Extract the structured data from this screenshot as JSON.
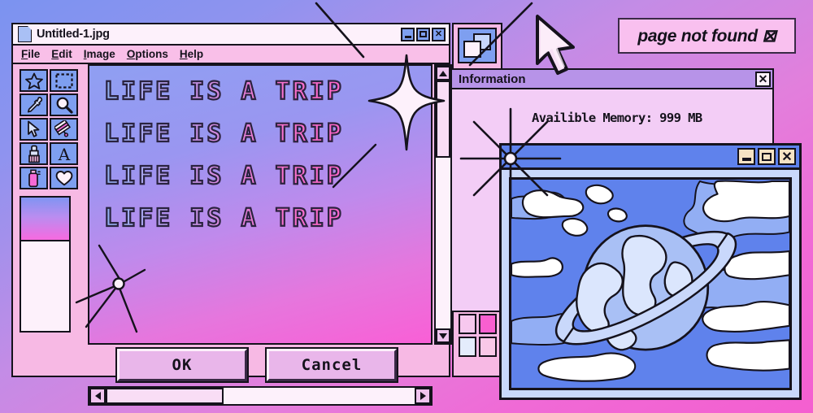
{
  "background": {
    "gradient_from": "#7b93f0",
    "gradient_to": "#f45fd0"
  },
  "paint_window": {
    "title": "Untitled-1.jpg",
    "doc_icon": "document-icon",
    "menu": [
      {
        "label": "File",
        "accel": "F"
      },
      {
        "label": "Edit",
        "accel": "E"
      },
      {
        "label": "Image",
        "accel": "I"
      },
      {
        "label": "Options",
        "accel": "O"
      },
      {
        "label": "Help",
        "accel": "H"
      }
    ],
    "window_buttons": [
      {
        "name": "minimize-button",
        "glyph": "_"
      },
      {
        "name": "maximize-button",
        "glyph": "□"
      },
      {
        "name": "close-button",
        "glyph": "✕"
      }
    ],
    "tools": [
      {
        "name": "star-tool",
        "icon": "star-icon"
      },
      {
        "name": "select-tool",
        "icon": "dashed-selection-icon"
      },
      {
        "name": "eyedropper-tool",
        "icon": "eyedropper-icon"
      },
      {
        "name": "zoom-tool",
        "icon": "magnifier-icon"
      },
      {
        "name": "pointer-tool",
        "icon": "cursor-arrow-icon"
      },
      {
        "name": "roller-tool",
        "icon": "paint-roller-icon"
      },
      {
        "name": "brush-tool",
        "icon": "paintbrush-icon"
      },
      {
        "name": "text-tool",
        "icon": "letter-a-icon"
      },
      {
        "name": "spray-tool",
        "icon": "spray-can-icon"
      },
      {
        "name": "heart-tool",
        "icon": "heart-icon"
      }
    ],
    "active_color_gradient": [
      "#8094f2",
      "#f76ae0"
    ],
    "canvas_text_lines": [
      "LIFE IS A TRIP",
      "LIFE IS A TRIP",
      "LIFE IS A TRIP",
      "LIFE IS A TRIP"
    ],
    "buttons": {
      "ok_label": "OK",
      "cancel_label": "Cancel"
    },
    "scrollbars": {
      "vertical": {
        "up_arrow": "▲",
        "down_arrow": "▼"
      },
      "horizontal": {
        "left_arrow": "◀",
        "right_arrow": "▶"
      }
    }
  },
  "palette_panel": {
    "copy_icon": "copy-windows-icon",
    "swatches": [
      "#7e9ff0",
      "#fdf1fb",
      "#f9bfe8",
      "#0b5cf0",
      "#f98fdc",
      "#ffffff",
      "#9db4f4",
      "#f6bcdf",
      "#f76ad6",
      "#a9c0f5",
      "#f97fd8",
      "#9db4f4",
      "#f7c8ee",
      "#f95fd0",
      "#e4ecfc",
      "#f9c8e8"
    ]
  },
  "info_window": {
    "title": "Information",
    "close_glyph": "✕",
    "message": "Availible Memory: 999 MB"
  },
  "planet_window": {
    "window_buttons": [
      {
        "name": "minimize-button",
        "glyph": "_"
      },
      {
        "name": "maximize-button",
        "glyph": "□"
      },
      {
        "name": "close-button",
        "glyph": "✕"
      }
    ],
    "artwork": "ringed-planet-with-clouds",
    "sky_color": "#5f82ec",
    "cloud_color": "#ffffff"
  },
  "page_not_found_badge": {
    "text": "page not found ⊠"
  },
  "decorations": {
    "cursor": "mouse-pointer-icon",
    "sparkles": 4
  }
}
